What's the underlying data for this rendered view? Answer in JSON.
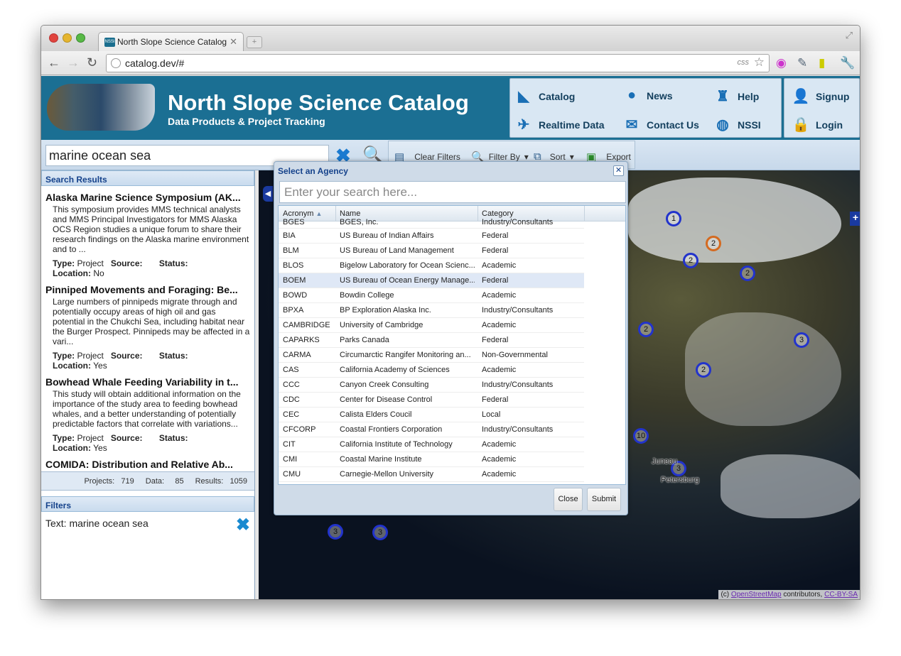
{
  "browser": {
    "tab_title": "North Slope Science Catalog",
    "tab_favicon": "NSSI",
    "url": "catalog.dev/#",
    "css_badge": "css"
  },
  "header": {
    "title": "North Slope Science Catalog",
    "subtitle": "Data Products & Project Tracking",
    "nav": [
      {
        "label": "Catalog",
        "icon": "map-icon"
      },
      {
        "label": "News",
        "icon": "chat-icon"
      },
      {
        "label": "Help",
        "icon": "help-icon"
      },
      {
        "label": "Realtime Data",
        "icon": "satellite-icon"
      },
      {
        "label": "Contact Us",
        "icon": "mail-icon"
      },
      {
        "label": "NSSI",
        "icon": "globe-icon"
      }
    ],
    "auth": [
      {
        "label": "Signup",
        "icon": "user-icon"
      },
      {
        "label": "Login",
        "icon": "lock-icon"
      }
    ]
  },
  "search": {
    "query": "marine ocean sea"
  },
  "toolbar": {
    "clear_filters": "Clear Filters",
    "filter_by": "Filter By",
    "sort": "Sort",
    "export": "Export"
  },
  "results_panel": {
    "title": "Search Results",
    "items": [
      {
        "title": "Alaska Marine Science Symposium (AK...",
        "desc": "This symposium provides MMS technical analysts and MMS Principal Investigators for MMS Alaska OCS Region studies a unique forum to share their research findings on the Alaska marine environment and to ...",
        "type_label": "Type:",
        "type": "Project",
        "source_label": "Source:",
        "status_label": "Status:",
        "location_label": "Location:",
        "location": "No"
      },
      {
        "title": "Pinniped Movements and Foraging: Be...",
        "desc": "Large numbers of pinnipeds migrate through and potentially occupy areas of high oil and gas potential in the Chukchi Sea, including habitat near the Burger Prospect. Pinnipeds may be affected in a vari...",
        "type_label": "Type:",
        "type": "Project",
        "source_label": "Source:",
        "status_label": "Status:",
        "location_label": "Location:",
        "location": "Yes"
      },
      {
        "title": "Bowhead Whale Feeding Variability in t...",
        "desc": "This study will obtain additional information on the importance of the study area to feeding bowhead whales, and a better understanding of potentially predictable factors that correlate with variations...",
        "type_label": "Type:",
        "type": "Project",
        "source_label": "Source:",
        "status_label": "Status:",
        "location_label": "Location:",
        "location": "Yes"
      },
      {
        "title": "COMIDA: Distribution and Relative Ab..."
      }
    ],
    "counts": {
      "projects_label": "Projects:",
      "projects": "719",
      "data_label": "Data:",
      "data": "85",
      "results_label": "Results:",
      "results": "1059"
    }
  },
  "filters_panel": {
    "title": "Filters",
    "text_filter": "Text: marine ocean sea"
  },
  "map": {
    "markers": [
      "1",
      "2",
      "2",
      "2",
      "2",
      "3",
      "2",
      "10",
      "3",
      "3",
      "3"
    ],
    "labels": [
      "Juneau",
      "Petersburg"
    ],
    "attribution_prefix": "(c)",
    "attribution_link1": "OpenStreetMap",
    "attribution_mid": "contributors,",
    "attribution_link2": "CC-BY-SA"
  },
  "agency_dialog": {
    "title": "Select an Agency",
    "search_placeholder": "Enter your search here...",
    "columns": [
      "Acronym",
      "Name",
      "Category"
    ],
    "partial_row": {
      "acronym": "BGES",
      "name": "BGES, Inc.",
      "category": "Industry/Consultants"
    },
    "rows": [
      {
        "acronym": "BIA",
        "name": "US Bureau of Indian Affairs",
        "category": "Federal"
      },
      {
        "acronym": "BLM",
        "name": "US Bureau of Land Management",
        "category": "Federal"
      },
      {
        "acronym": "BLOS",
        "name": "Bigelow Laboratory for Ocean Scienc...",
        "category": "Academic"
      },
      {
        "acronym": "BOEM",
        "name": "US Bureau of Ocean Energy Manage...",
        "category": "Federal"
      },
      {
        "acronym": "BOWD",
        "name": "Bowdin College",
        "category": "Academic"
      },
      {
        "acronym": "BPXA",
        "name": "BP Exploration Alaska Inc.",
        "category": "Industry/Consultants"
      },
      {
        "acronym": "CAMBRIDGE",
        "name": "University of Cambridge",
        "category": "Academic"
      },
      {
        "acronym": "CAPARKS",
        "name": "Parks Canada",
        "category": "Federal"
      },
      {
        "acronym": "CARMA",
        "name": "Circumarctic Rangifer Monitoring an...",
        "category": "Non-Governmental"
      },
      {
        "acronym": "CAS",
        "name": "California Academy of Sciences",
        "category": "Academic"
      },
      {
        "acronym": "CCC",
        "name": "Canyon Creek Consulting",
        "category": "Industry/Consultants"
      },
      {
        "acronym": "CDC",
        "name": "Center for Disease Control",
        "category": "Federal"
      },
      {
        "acronym": "CEC",
        "name": "Calista Elders Coucil",
        "category": "Local"
      },
      {
        "acronym": "CFCORP",
        "name": "Coastal Frontiers Corporation",
        "category": "Industry/Consultants"
      },
      {
        "acronym": "CIT",
        "name": "California Institute of Technology",
        "category": "Academic"
      },
      {
        "acronym": "CMI",
        "name": "Coastal Marine Institute",
        "category": "Academic"
      },
      {
        "acronym": "CMU",
        "name": "Carnegie-Mellon University",
        "category": "Academic"
      }
    ],
    "selected_acronym": "BOEM",
    "close_label": "Close",
    "submit_label": "Submit"
  }
}
